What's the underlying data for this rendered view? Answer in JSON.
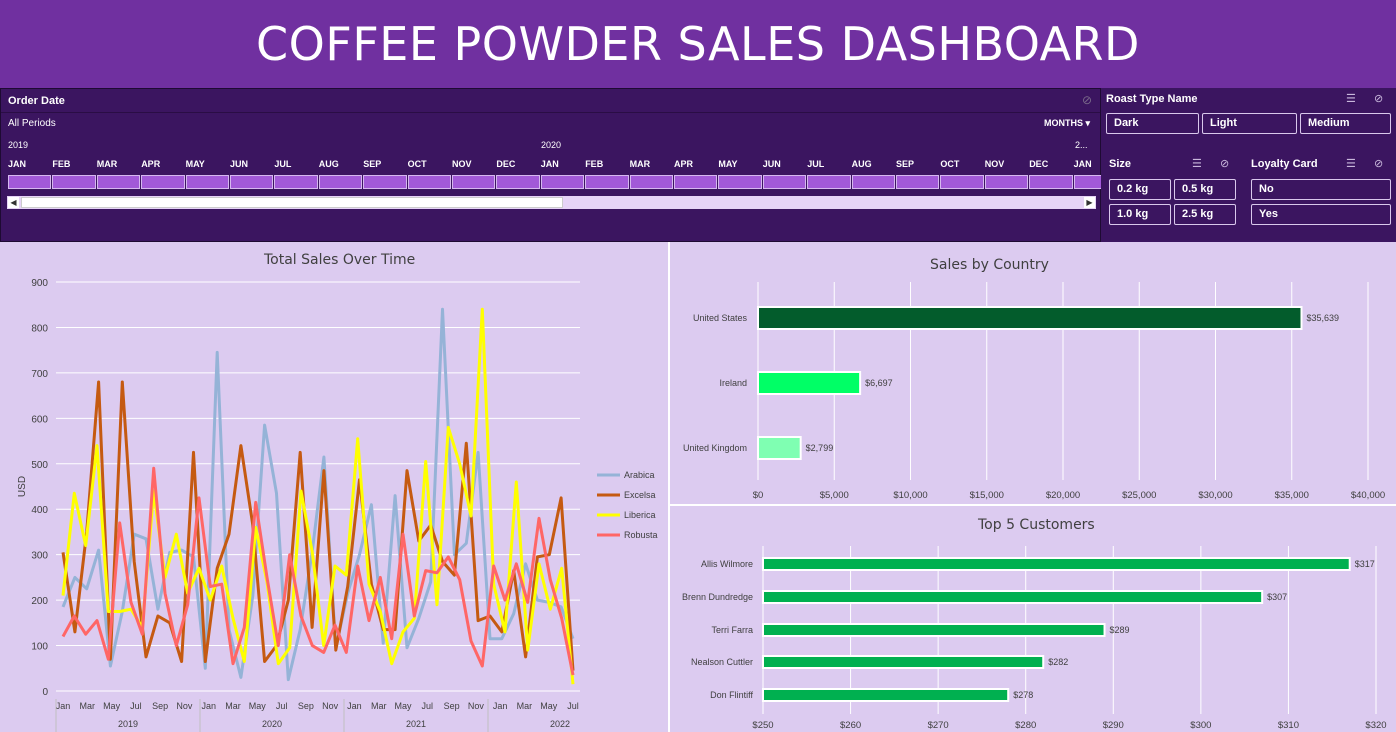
{
  "header": {
    "title": "COFFEE POWDER SALES DASHBOARD"
  },
  "timeline": {
    "title": "Order Date",
    "period": "All Periods",
    "granularity": "MONTHS ▾",
    "years": [
      {
        "label": "2019"
      },
      {
        "label": "2020"
      },
      {
        "label": "2..."
      }
    ],
    "months": [
      "JAN",
      "FEB",
      "MAR",
      "APR",
      "MAY",
      "JUN",
      "JUL",
      "AUG",
      "SEP",
      "OCT",
      "NOV",
      "DEC",
      "JAN",
      "FEB",
      "MAR",
      "APR",
      "MAY",
      "JUN",
      "JUL",
      "AUG",
      "SEP",
      "OCT",
      "NOV",
      "DEC",
      "JAN"
    ]
  },
  "slicers": {
    "roast": {
      "title": "Roast Type Name",
      "items": [
        "Dark",
        "Light",
        "Medium"
      ]
    },
    "size": {
      "title": "Size",
      "items": [
        "0.2 kg",
        "0.5 kg",
        "1.0 kg",
        "2.5 kg"
      ]
    },
    "loyalty": {
      "title": "Loyalty Card",
      "items": [
        "No",
        "Yes"
      ]
    }
  },
  "colors": {
    "header": "#7030a0",
    "slicer_bg": "#3b1560",
    "panel_bg": "#dccbf0",
    "arabica": "#95b3d7",
    "excelsa": "#c55a11",
    "liberica": "#ffff00",
    "robusta": "#ff6666",
    "us_bar": "#035c2c",
    "ireland_bar": "#00ff66",
    "uk_bar": "#7fffb2",
    "customer_bar": "#00b050"
  },
  "chart_data": [
    {
      "type": "line",
      "title": "Total Sales Over Time",
      "ylabel": "USD",
      "ylim": [
        0,
        900
      ],
      "yticks": [
        0,
        100,
        200,
        300,
        400,
        500,
        600,
        700,
        800,
        900
      ],
      "x_month_labels": [
        "Jan",
        "Mar",
        "May",
        "Jul",
        "Sep",
        "Nov",
        "Jan",
        "Mar",
        "May",
        "Jul",
        "Sep",
        "Nov",
        "Jan",
        "Mar",
        "May",
        "Jul",
        "Sep",
        "Nov",
        "Jan",
        "Mar",
        "May",
        "Jul"
      ],
      "x_year_labels": [
        "2019",
        "2020",
        "2021",
        "2022"
      ],
      "series": [
        {
          "name": "Arabica",
          "values": [
            185,
            250,
            225,
            310,
            55,
            175,
            345,
            335,
            180,
            305,
            310,
            295,
            50,
            745,
            135,
            30,
            210,
            585,
            435,
            25,
            135,
            305,
            515,
            95,
            215,
            300,
            410,
            105,
            430,
            95,
            160,
            240,
            840,
            300,
            325,
            525,
            115,
            115,
            170,
            280,
            200,
            195,
            185,
            115
          ]
        },
        {
          "name": "Excelsa",
          "values": [
            305,
            130,
            350,
            680,
            70,
            680,
            285,
            75,
            165,
            150,
            65,
            525,
            65,
            270,
            345,
            540,
            365,
            65,
            100,
            200,
            525,
            140,
            485,
            90,
            230,
            465,
            235,
            135,
            135,
            485,
            330,
            365,
            285,
            255,
            545,
            155,
            165,
            130,
            265,
            75,
            295,
            300,
            425,
            45
          ]
        },
        {
          "name": "Liberica",
          "values": [
            210,
            435,
            320,
            540,
            175,
            175,
            180,
            140,
            440,
            250,
            345,
            215,
            270,
            200,
            275,
            160,
            65,
            360,
            240,
            60,
            95,
            440,
            305,
            100,
            275,
            255,
            555,
            235,
            175,
            60,
            130,
            160,
            505,
            190,
            580,
            500,
            385,
            840,
            235,
            130,
            460,
            90,
            280,
            180,
            270,
            15
          ]
        },
        {
          "name": "Robusta",
          "values": [
            120,
            165,
            125,
            155,
            70,
            370,
            195,
            125,
            490,
            215,
            100,
            190,
            425,
            230,
            235,
            60,
            140,
            415,
            250,
            100,
            300,
            165,
            100,
            85,
            145,
            85,
            275,
            155,
            250,
            115,
            345,
            165,
            265,
            260,
            295,
            245,
            110,
            55,
            275,
            200,
            280,
            195,
            380,
            245,
            160,
            35
          ]
        }
      ]
    },
    {
      "type": "bar",
      "title": "Sales by Country",
      "categories": [
        "United States",
        "Ireland",
        "United Kingdom"
      ],
      "values": [
        35639,
        6697,
        2799
      ],
      "value_labels": [
        "$35,639",
        "$6,697",
        "$2,799"
      ],
      "xlim": [
        0,
        40000
      ],
      "xtick_labels": [
        "$0",
        "$5,000",
        "$10,000",
        "$15,000",
        "$20,000",
        "$25,000",
        "$30,000",
        "$35,000",
        "$40,000"
      ]
    },
    {
      "type": "bar",
      "title": "Top 5 Customers",
      "categories": [
        "Allis Wilmore",
        "Brenn Dundredge",
        "Terri Farra",
        "Nealson Cuttler",
        "Don Flintiff"
      ],
      "values": [
        317,
        307,
        289,
        282,
        278
      ],
      "value_labels": [
        "$317",
        "$307",
        "$289",
        "$282",
        "$278"
      ],
      "xlim": [
        250,
        320
      ],
      "xtick_labels": [
        "$250",
        "$260",
        "$270",
        "$280",
        "$290",
        "$300",
        "$310",
        "$320"
      ]
    }
  ]
}
